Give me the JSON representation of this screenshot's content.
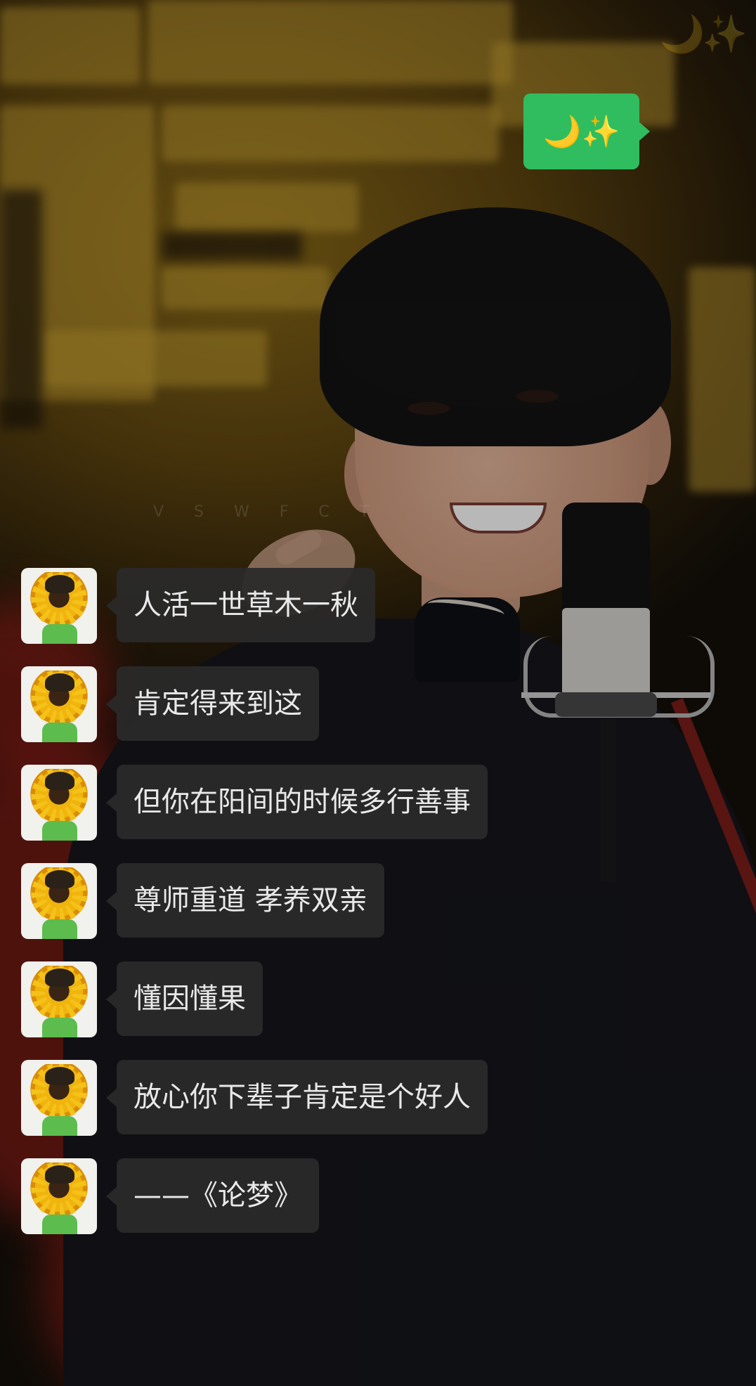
{
  "decor": {
    "corner": "🌙✨"
  },
  "sent_message": {
    "text": "🌙✨"
  },
  "messages": [
    {
      "sender": "sunflower-avatar",
      "text": "人活一世草木一秋"
    },
    {
      "sender": "sunflower-avatar",
      "text": "肯定得来到这"
    },
    {
      "sender": "sunflower-avatar",
      "text": "但你在阳间的时候多行善事"
    },
    {
      "sender": "sunflower-avatar",
      "text": "尊师重道 孝养双亲"
    },
    {
      "sender": "sunflower-avatar",
      "text": "懂因懂果"
    },
    {
      "sender": "sunflower-avatar",
      "text": "放心你下辈子肯定是个好人"
    },
    {
      "sender": "sunflower-avatar",
      "text": "——《论梦》"
    }
  ],
  "watermark": "V S W F C T",
  "colors": {
    "sent_bubble": "#2fbd5f",
    "received_bubble": "#2a2a2a",
    "received_text": "#e9e9e9"
  }
}
